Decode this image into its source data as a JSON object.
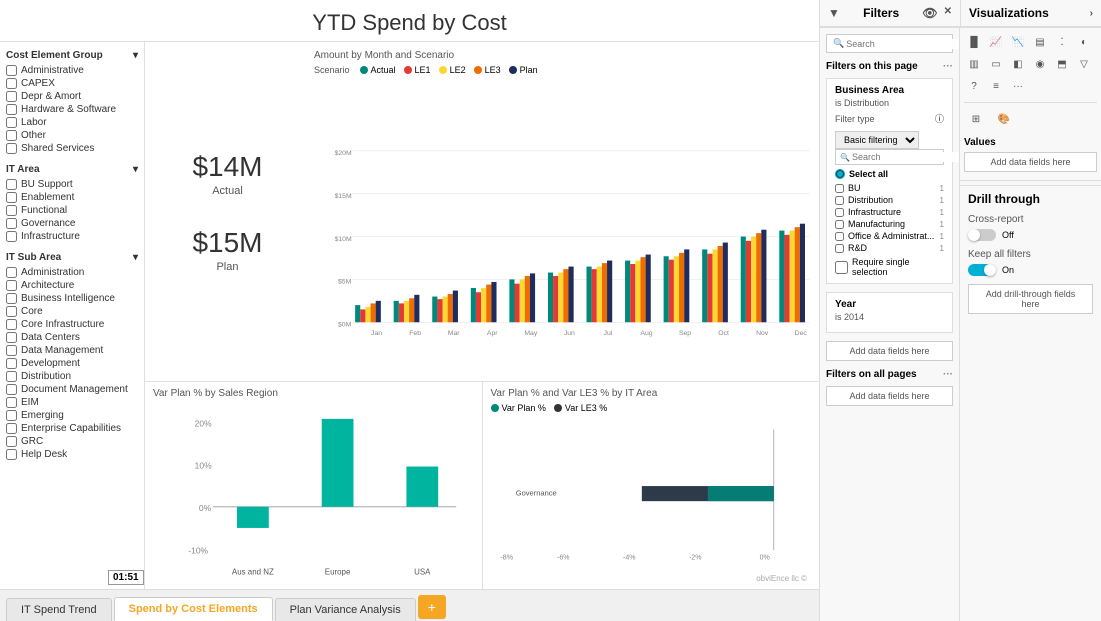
{
  "page": {
    "title": "YTD Spend by Cost",
    "big_number_1": "$14M",
    "big_label_1": "Actual",
    "big_number_2": "$15M",
    "big_label_2": "Plan"
  },
  "filters_panel": {
    "title": "Filters",
    "search_placeholder": "Search",
    "filters_on_page_label": "Filters on this page",
    "filters_on_all_label": "Filters on all pages",
    "business_area_title": "Business Area",
    "business_area_sub": "is Distribution",
    "filter_type_label": "Filter type",
    "filter_type_hint": "ⓘ",
    "filter_type_value": "Basic filtering",
    "inner_search_placeholder": "Search",
    "select_all_label": "Select all",
    "options": [
      {
        "label": "BU",
        "count": "1"
      },
      {
        "label": "Distribution",
        "count": "1"
      },
      {
        "label": "Infrastructure",
        "count": "1"
      },
      {
        "label": "Manufacturing",
        "count": "1"
      },
      {
        "label": "Office & Administrat...",
        "count": "1"
      },
      {
        "label": "R&D",
        "count": "1"
      }
    ],
    "require_single_label": "Require single selection",
    "year_title": "Year",
    "year_sub": "is 2014",
    "add_fields_label": "Add data fields here",
    "add_fields_all_label": "Add data fields here"
  },
  "drill_through": {
    "title": "Drill through",
    "cross_report_label": "Cross-report",
    "cross_report_value": "Off",
    "keep_filters_label": "Keep all filters",
    "keep_filters_value": "On",
    "add_drill_label": "Add drill-through fields here"
  },
  "visualizations": {
    "title": "Visualizations",
    "values_label": "Values",
    "add_data_label": "Add data fields here"
  },
  "cost_element_group": {
    "title": "Cost Element Group",
    "items": [
      "Administrative",
      "CAPEX",
      "Depr & Amort",
      "Hardware & Software",
      "Labor",
      "Other",
      "Shared Services"
    ]
  },
  "it_area": {
    "title": "IT Area",
    "items": [
      "BU Support",
      "Enablement",
      "Functional",
      "Governance",
      "Infrastructure"
    ]
  },
  "it_sub_area": {
    "title": "IT Sub Area",
    "items": [
      "Administration",
      "Architecture",
      "Business Intelligence",
      "Core",
      "Core Infrastructure",
      "Data Centers",
      "Data Management",
      "Development",
      "Distribution",
      "Document Management",
      "EIM",
      "Emerging",
      "Enterprise Capabilities",
      "GRC",
      "Help Desk"
    ]
  },
  "top_chart": {
    "title": "Amount by Month and Scenario",
    "scenario_label": "Scenario",
    "legend": [
      {
        "label": "Actual",
        "color": "#00897b"
      },
      {
        "label": "LE1",
        "color": "#e53935"
      },
      {
        "label": "LE2",
        "color": "#fdd835"
      },
      {
        "label": "LE3",
        "color": "#ef6c00"
      },
      {
        "label": "Plan",
        "color": "#1e2d5e"
      }
    ],
    "months": [
      "Jan",
      "Feb",
      "Mar",
      "Apr",
      "May",
      "Jun",
      "Jul",
      "Aug",
      "Sep",
      "Oct",
      "Nov",
      "Dec"
    ],
    "y_labels": [
      "$0M",
      "$5M",
      "$10M",
      "$15M",
      "$20M"
    ]
  },
  "bottom_left_chart": {
    "title": "Var Plan % by Sales Region",
    "y_labels": [
      "20%",
      "10%",
      "0%",
      "-10%"
    ],
    "x_labels": [
      "Aus and NZ",
      "Europe",
      "USA"
    ]
  },
  "bottom_right_chart": {
    "title": "Var Plan % and Var LE3 % by IT Area",
    "legend": [
      {
        "label": "Var Plan %",
        "color": "#00897b"
      },
      {
        "label": "Var LE3 %",
        "color": "#333"
      }
    ],
    "x_labels": [
      "-8%",
      "-6%",
      "-4%",
      "-2%",
      "0%"
    ],
    "row_label": "Governance"
  },
  "tabs": [
    {
      "label": "IT Spend Trend",
      "active": false
    },
    {
      "label": "Spend by Cost Elements",
      "active": true
    },
    {
      "label": "Plan Variance Analysis",
      "active": false
    }
  ],
  "tab_add_label": "+",
  "timestamp": "01:51",
  "watermark": "obviEnce llc ©"
}
